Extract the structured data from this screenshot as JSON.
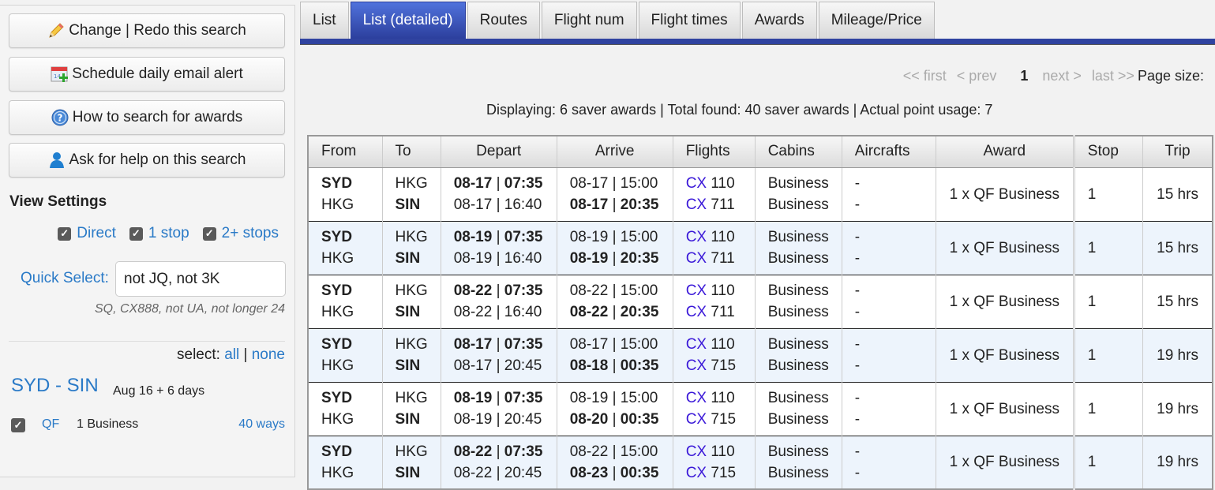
{
  "sidebar": {
    "buttons": [
      {
        "label": "Change | Redo this search",
        "icon": "pencil-icon"
      },
      {
        "label": "Schedule daily email alert",
        "icon": "calendar-add-icon"
      },
      {
        "label": "How to search for awards",
        "icon": "help-icon"
      },
      {
        "label": "Ask for help on this search",
        "icon": "user-icon"
      }
    ],
    "view_settings_title": "View Settings",
    "stops": [
      {
        "label": "Direct",
        "checked": true
      },
      {
        "label": "1 stop",
        "checked": true
      },
      {
        "label": "2+ stops",
        "checked": true
      }
    ],
    "quick_select_label": "Quick Select:",
    "quick_select_value": "not JQ, not 3K",
    "quick_select_hint": "SQ, CX888, not UA, not longer 24",
    "select_label": "select:",
    "select_all": "all",
    "select_sep": "|",
    "select_none": "none",
    "route": "SYD - SIN",
    "route_dates": "Aug 16 + 6 days",
    "airline": {
      "code": "QF",
      "cabin": "1 Business",
      "ways": "40 ways",
      "checked": true
    }
  },
  "tabs": [
    {
      "label": "List",
      "active": false
    },
    {
      "label": "List (detailed)",
      "active": true
    },
    {
      "label": "Routes",
      "active": false
    },
    {
      "label": "Flight num",
      "active": false
    },
    {
      "label": "Flight times",
      "active": false
    },
    {
      "label": "Awards",
      "active": false
    },
    {
      "label": "Mileage/Price",
      "active": false
    }
  ],
  "pager": {
    "first": "<< first",
    "prev": "< prev",
    "current": "1",
    "next": "next >",
    "last": "last >>",
    "page_size_label": "Page size:"
  },
  "summary": "Displaying: 6 saver awards | Total found: 40 saver awards | Actual point usage: 7",
  "table": {
    "headers": [
      "From",
      "To",
      "Depart",
      "Arrive",
      "Flights",
      "Cabins",
      "Aircrafts",
      "Award",
      "Stop",
      "Trip"
    ],
    "rows": [
      {
        "from": [
          "SYD",
          "HKG"
        ],
        "to": [
          "HKG",
          "SIN"
        ],
        "depart": [
          [
            "08-17",
            "07:35"
          ],
          [
            "08-17",
            "16:40"
          ]
        ],
        "arrive": [
          [
            "08-17",
            "15:00"
          ],
          [
            "08-17",
            "20:35"
          ]
        ],
        "flights": [
          [
            "CX",
            "110"
          ],
          [
            "CX",
            "711"
          ]
        ],
        "cabins": [
          "Business",
          "Business"
        ],
        "aircrafts": [
          "-",
          "-"
        ],
        "award": "1 x QF Business",
        "stop": "1",
        "trip": "15 hrs"
      },
      {
        "from": [
          "SYD",
          "HKG"
        ],
        "to": [
          "HKG",
          "SIN"
        ],
        "depart": [
          [
            "08-19",
            "07:35"
          ],
          [
            "08-19",
            "16:40"
          ]
        ],
        "arrive": [
          [
            "08-19",
            "15:00"
          ],
          [
            "08-19",
            "20:35"
          ]
        ],
        "flights": [
          [
            "CX",
            "110"
          ],
          [
            "CX",
            "711"
          ]
        ],
        "cabins": [
          "Business",
          "Business"
        ],
        "aircrafts": [
          "-",
          "-"
        ],
        "award": "1 x QF Business",
        "stop": "1",
        "trip": "15 hrs"
      },
      {
        "from": [
          "SYD",
          "HKG"
        ],
        "to": [
          "HKG",
          "SIN"
        ],
        "depart": [
          [
            "08-22",
            "07:35"
          ],
          [
            "08-22",
            "16:40"
          ]
        ],
        "arrive": [
          [
            "08-22",
            "15:00"
          ],
          [
            "08-22",
            "20:35"
          ]
        ],
        "flights": [
          [
            "CX",
            "110"
          ],
          [
            "CX",
            "711"
          ]
        ],
        "cabins": [
          "Business",
          "Business"
        ],
        "aircrafts": [
          "-",
          "-"
        ],
        "award": "1 x QF Business",
        "stop": "1",
        "trip": "15 hrs"
      },
      {
        "from": [
          "SYD",
          "HKG"
        ],
        "to": [
          "HKG",
          "SIN"
        ],
        "depart": [
          [
            "08-17",
            "07:35"
          ],
          [
            "08-17",
            "20:45"
          ]
        ],
        "arrive": [
          [
            "08-17",
            "15:00"
          ],
          [
            "08-18",
            "00:35"
          ]
        ],
        "flights": [
          [
            "CX",
            "110"
          ],
          [
            "CX",
            "715"
          ]
        ],
        "cabins": [
          "Business",
          "Business"
        ],
        "aircrafts": [
          "-",
          "-"
        ],
        "award": "1 x QF Business",
        "stop": "1",
        "trip": "19 hrs"
      },
      {
        "from": [
          "SYD",
          "HKG"
        ],
        "to": [
          "HKG",
          "SIN"
        ],
        "depart": [
          [
            "08-19",
            "07:35"
          ],
          [
            "08-19",
            "20:45"
          ]
        ],
        "arrive": [
          [
            "08-19",
            "15:00"
          ],
          [
            "08-20",
            "00:35"
          ]
        ],
        "flights": [
          [
            "CX",
            "110"
          ],
          [
            "CX",
            "715"
          ]
        ],
        "cabins": [
          "Business",
          "Business"
        ],
        "aircrafts": [
          "-",
          "-"
        ],
        "award": "1 x QF Business",
        "stop": "1",
        "trip": "19 hrs"
      },
      {
        "from": [
          "SYD",
          "HKG"
        ],
        "to": [
          "HKG",
          "SIN"
        ],
        "depart": [
          [
            "08-22",
            "07:35"
          ],
          [
            "08-22",
            "20:45"
          ]
        ],
        "arrive": [
          [
            "08-22",
            "15:00"
          ],
          [
            "08-23",
            "00:35"
          ]
        ],
        "flights": [
          [
            "CX",
            "110"
          ],
          [
            "CX",
            "715"
          ]
        ],
        "cabins": [
          "Business",
          "Business"
        ],
        "aircrafts": [
          "-",
          "-"
        ],
        "award": "1 x QF Business",
        "stop": "1",
        "trip": "19 hrs"
      }
    ]
  }
}
